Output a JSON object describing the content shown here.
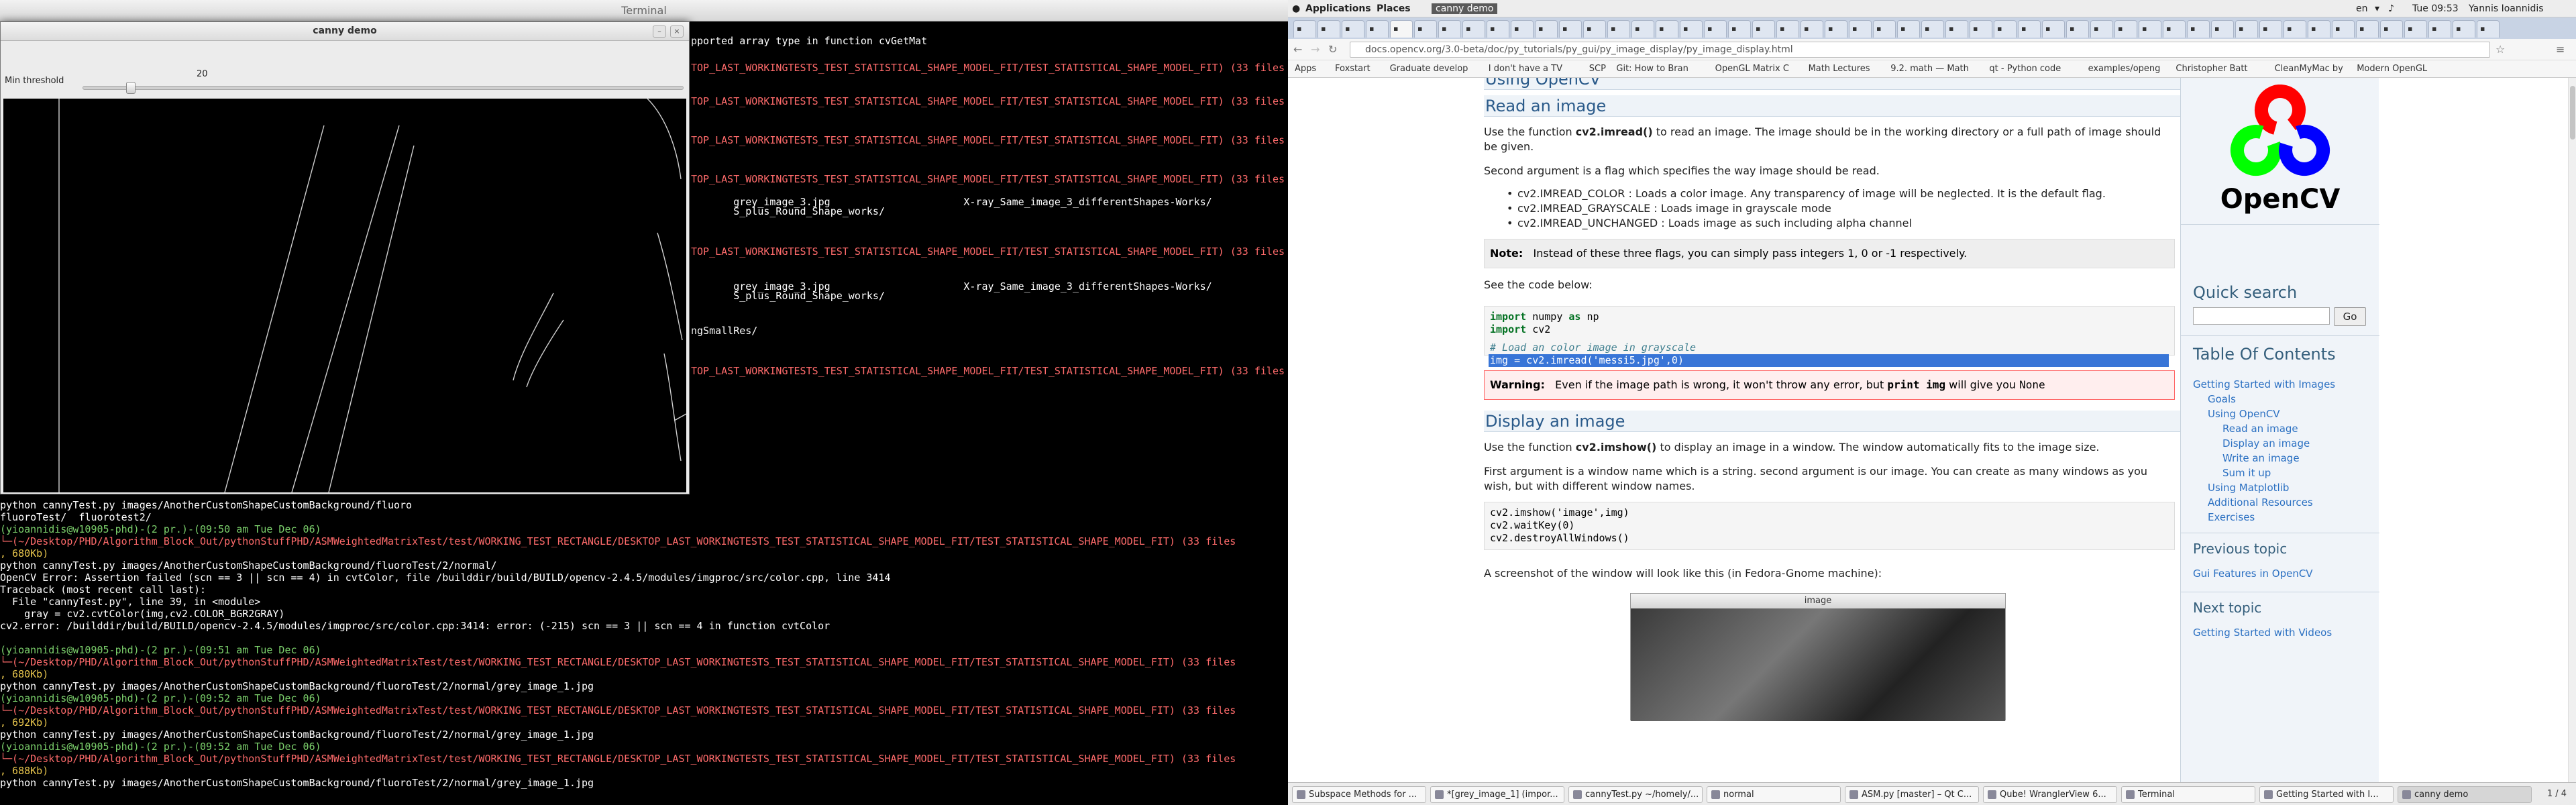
{
  "terminal": {
    "title": "Terminal",
    "lines_top": [
      {
        "t": "pported array type in function cvGetMat",
        "c": "wht"
      },
      {
        "t": "TOP_LAST_WORKINGTESTS_TEST_STATISTICAL_SHAPE_MODEL_FIT/TEST_STATISTICAL_SHAPE_MODEL_FIT) (33 files",
        "c": "red"
      },
      {
        "t": "TOP_LAST_WORKINGTESTS_TEST_STATISTICAL_SHAPE_MODEL_FIT/TEST_STATISTICAL_SHAPE_MODEL_FIT) (33 files",
        "c": "red"
      },
      {
        "t": "TOP_LAST_WORKINGTESTS_TEST_STATISTICAL_SHAPE_MODEL_FIT/TEST_STATISTICAL_SHAPE_MODEL_FIT) (33 files",
        "c": "red"
      },
      {
        "t": "TOP_LAST_WORKINGTESTS_TEST_STATISTICAL_SHAPE_MODEL_FIT/TEST_STATISTICAL_SHAPE_MODEL_FIT) (33 files",
        "c": "red"
      },
      {
        "t": "       grey_image_3.jpg                      X-ray_Same_image_3_differentShapes-Works/",
        "c": "wht"
      },
      {
        "t": "       S_plus_Round_Shape_works/",
        "c": "wht"
      },
      {
        "t": "TOP_LAST_WORKINGTESTS_TEST_STATISTICAL_SHAPE_MODEL_FIT/TEST_STATISTICAL_SHAPE_MODEL_FIT) (33 files",
        "c": "red"
      },
      {
        "t": "       grey_image_3.jpg                      X-ray_Same_image_3_differentShapes-Works/",
        "c": "wht"
      },
      {
        "t": "       S_plus_Round_Shape_works/",
        "c": "wht"
      },
      {
        "t": "ngSmallRes/",
        "c": "wht"
      },
      {
        "t": "TOP_LAST_WORKINGTESTS_TEST_STATISTICAL_SHAPE_MODEL_FIT/TEST_STATISTICAL_SHAPE_MODEL_FIT) (33 files",
        "c": "red"
      }
    ],
    "lines_bottom": [
      {
        "t": "python cannyTest.py images/AnotherCustomShapeCustomBackground/fluoro",
        "c": "wht"
      },
      {
        "t": "fluoroTest/  fluorotest2/",
        "c": "wht"
      },
      {
        "t": "(yioannidis@w10905-phd)-(2 pr.)-(09:50 am Tue Dec 06)",
        "c": "grn"
      },
      {
        "t": "└─(~/Desktop/PHD/Algorithm_Block_Out/pythonStuffPHD/ASMWeightedMatrixTest/test/WORKING_TEST_RECTANGLE/DESKTOP_LAST_WORKINGTESTS_TEST_STATISTICAL_SHAPE_MODEL_FIT/TEST_STATISTICAL_SHAPE_MODEL_FIT) (33 files",
        "c": "red"
      },
      {
        "t": ", 680Kb)",
        "c": "yel"
      },
      {
        "t": "python cannyTest.py images/AnotherCustomShapeCustomBackground/fluoroTest/2/normal/",
        "c": "wht"
      },
      {
        "t": "OpenCV Error: Assertion failed (scn == 3 || scn == 4) in cvtColor, file /builddir/build/BUILD/opencv-2.4.5/modules/imgproc/src/color.cpp, line 3414",
        "c": "wht"
      },
      {
        "t": "Traceback (most recent call last):",
        "c": "wht"
      },
      {
        "t": "  File \"cannyTest.py\", line 39, in <module>",
        "c": "wht"
      },
      {
        "t": "    gray = cv2.cvtColor(img,cv2.COLOR_BGR2GRAY)",
        "c": "wht"
      },
      {
        "t": "cv2.error: /builddir/build/BUILD/opencv-2.4.5/modules/imgproc/src/color.cpp:3414: error: (-215) scn == 3 || scn == 4 in function cvtColor",
        "c": "wht"
      },
      {
        "t": "",
        "c": "wht"
      },
      {
        "t": "(yioannidis@w10905-phd)-(2 pr.)-(09:51 am Tue Dec 06)",
        "c": "grn"
      },
      {
        "t": "└─(~/Desktop/PHD/Algorithm_Block_Out/pythonStuffPHD/ASMWeightedMatrixTest/test/WORKING_TEST_RECTANGLE/DESKTOP_LAST_WORKINGTESTS_TEST_STATISTICAL_SHAPE_MODEL_FIT/TEST_STATISTICAL_SHAPE_MODEL_FIT) (33 files",
        "c": "red"
      },
      {
        "t": ", 680Kb)",
        "c": "yel"
      },
      {
        "t": "python cannyTest.py images/AnotherCustomShapeCustomBackground/fluoroTest/2/normal/grey_image_1.jpg",
        "c": "wht"
      },
      {
        "t": "(yioannidis@w10905-phd)-(2 pr.)-(09:52 am Tue Dec 06)",
        "c": "grn"
      },
      {
        "t": "└─(~/Desktop/PHD/Algorithm_Block_Out/pythonStuffPHD/ASMWeightedMatrixTest/test/WORKING_TEST_RECTANGLE/DESKTOP_LAST_WORKINGTESTS_TEST_STATISTICAL_SHAPE_MODEL_FIT/TEST_STATISTICAL_SHAPE_MODEL_FIT) (33 files",
        "c": "red"
      },
      {
        "t": ", 692Kb)",
        "c": "yel"
      },
      {
        "t": "python cannyTest.py images/AnotherCustomShapeCustomBackground/fluoroTest/2/normal/grey_image_1.jpg",
        "c": "wht"
      },
      {
        "t": "(yioannidis@w10905-phd)-(2 pr.)-(09:52 am Tue Dec 06)",
        "c": "grn"
      },
      {
        "t": "└─(~/Desktop/PHD/Algorithm_Block_Out/pythonStuffPHD/ASMWeightedMatrixTest/test/WORKING_TEST_RECTANGLE/DESKTOP_LAST_WORKINGTESTS_TEST_STATISTICAL_SHAPE_MODEL_FIT/TEST_STATISTICAL_SHAPE_MODEL_FIT) (33 files",
        "c": "red"
      },
      {
        "t": ", 688Kb)",
        "c": "yel"
      },
      {
        "t": "python cannyTest.py images/AnotherCustomShapeCustomBackground/fluoroTest/2/normal/grey_image_1.jpg",
        "c": "wht"
      }
    ]
  },
  "canny": {
    "title": "canny demo",
    "slider_label": "Min threshold",
    "slider_value": "20",
    "slider_fraction": 0.08
  },
  "panel": {
    "applications": "Applications",
    "places": "Places",
    "active_app": "canny demo",
    "lang": "en",
    "clock": "Tue 09:53",
    "user": "Yannis Ioannidis"
  },
  "browser": {
    "url": "docs.opencv.org/3.0-beta/doc/py_tutorials/py_gui/py_image_display/py_image_display.html",
    "apps_label": "Apps",
    "bookmarks": [
      "Foxstart",
      "Graduate develop",
      "I don't have a TV",
      "SCP",
      "Git: How to Bran",
      "OpenGL Matrix C",
      "Math Lectures",
      "9.2. math — Math",
      "qt - Python code",
      "examples/openg",
      "Christopher Batt",
      "CleanMyMac by",
      "Modern OpenGL"
    ]
  },
  "doc": {
    "section_top": "Using OpenCV",
    "read_heading": "Read an image",
    "read_p1_pre": "Use the function ",
    "read_p1_fn": "cv2.imread()",
    "read_p1_post": " to read an image. The image should be in the working directory or a full path of image should be given.",
    "read_p2": "Second argument is a flag which specifies the way image should be read.",
    "flags": [
      "cv2.IMREAD_COLOR : Loads a color image. Any transparency of image will be neglected. It is the default flag.",
      "cv2.IMREAD_GRAYSCALE : Loads image in grayscale mode",
      "cv2.IMREAD_UNCHANGED : Loads image as such including alpha channel"
    ],
    "note_label": "Note:",
    "note_text": "Instead of these three flags, you can simply pass integers 1, 0 or -1 respectively.",
    "see_code": "See the code below:",
    "code1": {
      "l1_kw1": "import",
      "l1_mod": " numpy ",
      "l1_kw2": "as",
      "l1_alias": " np",
      "l2_kw": "import",
      "l2_mod": " cv2",
      "comment": "# Load an color image in grayscale",
      "selected": "img = cv2.imread('messi5.jpg',0)"
    },
    "warn_label": "Warning:",
    "warn_pre": "Even if the image path is wrong, it won't throw any error, but ",
    "warn_code": "print img",
    "warn_mid": " will give you ",
    "warn_none": "None",
    "display_heading": "Display an image",
    "disp_p1_pre": "Use the function ",
    "disp_p1_fn": "cv2.imshow()",
    "disp_p1_post": " to display an image in a window. The window automatically fits to the image size.",
    "disp_p2": "First argument is a window name which is a string. second argument is our image. You can create as many windows as you wish, but with different window names.",
    "code2": [
      "cv2.imshow('image',img)",
      "cv2.waitKey(0)",
      "cv2.destroyAllWindows()"
    ],
    "screenshot_caption": "A screenshot of the window will look like this (in Fedora-Gnome machine):",
    "screenshot_title": "image"
  },
  "sidebar": {
    "logo_text": "OpenCV",
    "quick_search": "Quick search",
    "go": "Go",
    "toc_heading": "Table Of Contents",
    "toc": [
      {
        "label": "Getting Started with Images",
        "lvl": 0
      },
      {
        "label": "Goals",
        "lvl": 1
      },
      {
        "label": "Using OpenCV",
        "lvl": 1
      },
      {
        "label": "Read an image",
        "lvl": 2
      },
      {
        "label": "Display an image",
        "lvl": 2
      },
      {
        "label": "Write an image",
        "lvl": 2
      },
      {
        "label": "Sum it up",
        "lvl": 2
      },
      {
        "label": "Using Matplotlib",
        "lvl": 1
      },
      {
        "label": "Additional Resources",
        "lvl": 1
      },
      {
        "label": "Exercises",
        "lvl": 1
      }
    ],
    "prev_heading": "Previous topic",
    "prev_link": "Gui Features in OpenCV",
    "next_heading": "Next topic",
    "next_link": "Getting Started with Videos"
  },
  "taskbar": {
    "items": [
      "Subspace Methods for ...",
      "*[grey_image_1] (impor...",
      "cannyTest.py ~/homely/...",
      "normal",
      "ASM.py [master] – Qt C...",
      "Qube! WranglerView 6...",
      "Terminal",
      "Getting Started with I...",
      "canny demo"
    ],
    "pager": "1 / 4"
  }
}
